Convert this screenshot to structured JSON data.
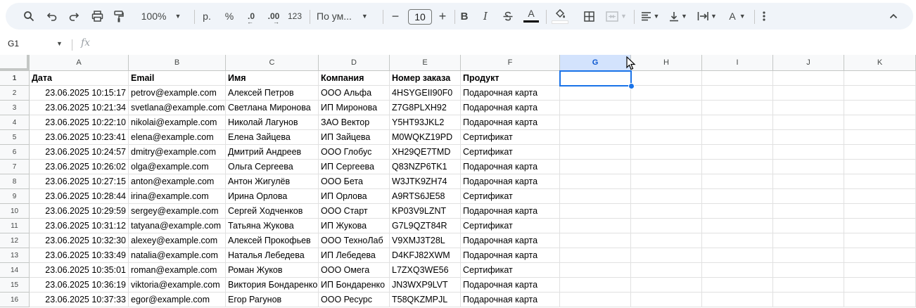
{
  "toolbar": {
    "zoom": "100%",
    "currency": "р.",
    "percent": "%",
    "dec_decrease": ".0",
    "dec_increase": ".00",
    "number_format": "123",
    "font_name": "По ум...",
    "font_size": "10",
    "minus": "−",
    "plus": "+",
    "bold": "B",
    "italic": "I",
    "text_color_letter": "A",
    "text_rotation_letter": "A"
  },
  "formula_bar": {
    "name_box": "G1",
    "fx": "fx",
    "content": ""
  },
  "columns": [
    "A",
    "B",
    "C",
    "D",
    "E",
    "F",
    "G",
    "H",
    "I",
    "J",
    "K"
  ],
  "selected_cell": "G1",
  "rows": [
    {
      "n": "1",
      "cells": [
        "Дата",
        "Email",
        "Имя",
        "Компания",
        "Номер заказа",
        "Продукт"
      ]
    },
    {
      "n": "2",
      "cells": [
        "23.06.2025 10:15:17",
        "petrov@example.com",
        "Алексей Петров",
        "ООО Альфа",
        "4HSYGEII90F0",
        "Подарочная карта"
      ]
    },
    {
      "n": "3",
      "cells": [
        "23.06.2025 10:21:34",
        "svetlana@example.com",
        "Светлана Миронова",
        "ИП Миронова",
        "Z7G8PLXH92",
        "Подарочная карта"
      ]
    },
    {
      "n": "4",
      "cells": [
        "23.06.2025 10:22:10",
        "nikolai@example.com",
        "Николай Лагунов",
        "ЗАО Вектор",
        "Y5HT93JKL2",
        "Подарочная карта"
      ]
    },
    {
      "n": "5",
      "cells": [
        "23.06.2025 10:23:41",
        "elena@example.com",
        "Елена Зайцева",
        "ИП Зайцева",
        "M0WQKZ19PD",
        "Сертификат"
      ]
    },
    {
      "n": "6",
      "cells": [
        "23.06.2025 10:24:57",
        "dmitry@example.com",
        "Дмитрий Андреев",
        "ООО Глобус",
        "XH29QE7TMD",
        "Сертификат"
      ]
    },
    {
      "n": "7",
      "cells": [
        "23.06.2025 10:26:02",
        "olga@example.com",
        "Ольга Сергеева",
        "ИП Сергеева",
        "Q83NZP6TK1",
        "Подарочная карта"
      ]
    },
    {
      "n": "8",
      "cells": [
        "23.06.2025 10:27:15",
        "anton@example.com",
        "Антон Жигулёв",
        "ООО Бета",
        "W3JTK9ZH74",
        "Подарочная карта"
      ]
    },
    {
      "n": "9",
      "cells": [
        "23.06.2025 10:28:44",
        "irina@example.com",
        "Ирина Орлова",
        "ИП Орлова",
        "A9RTS6JE58",
        "Сертификат"
      ]
    },
    {
      "n": "10",
      "cells": [
        "23.06.2025 10:29:59",
        "sergey@example.com",
        "Сергей Ходченков",
        "ООО Старт",
        "KP03V9LZNT",
        "Подарочная карта"
      ]
    },
    {
      "n": "11",
      "cells": [
        "23.06.2025 10:31:12",
        "tatyana@example.com",
        "Татьяна Жукова",
        "ИП Жукова",
        "G7L9QZT84R",
        "Сертификат"
      ]
    },
    {
      "n": "12",
      "cells": [
        "23.06.2025 10:32:30",
        "alexey@example.com",
        "Алексей Прокофьев",
        "ООО ТехноЛаб",
        "V9XMJ3T28L",
        "Подарочная карта"
      ]
    },
    {
      "n": "13",
      "cells": [
        "23.06.2025 10:33:49",
        "natalia@example.com",
        "Наталья Лебедева",
        "ИП Лебедева",
        "D4KFJ82XWM",
        "Подарочная карта"
      ]
    },
    {
      "n": "14",
      "cells": [
        "23.06.2025 10:35:01",
        "roman@example.com",
        "Роман Жуков",
        "ООО Омега",
        "L7ZXQ3WE56",
        "Сертификат"
      ]
    },
    {
      "n": "15",
      "cells": [
        "23.06.2025 10:36:19",
        "viktoria@example.com",
        "Виктория Бондаренко",
        "ИП Бондаренко",
        "JN3WXP9LVT",
        "Подарочная карта"
      ]
    },
    {
      "n": "16",
      "cells": [
        "23.06.2025 10:37:33",
        "egor@example.com",
        "Егор Рагунов",
        "ООО Ресурс",
        "T58QKZMPJL",
        "Подарочная карта"
      ]
    }
  ],
  "colors": {
    "accent": "#1a73e8",
    "selected_header_bg": "#d3e3fd",
    "toolbar_bg": "#f0f4f9"
  }
}
